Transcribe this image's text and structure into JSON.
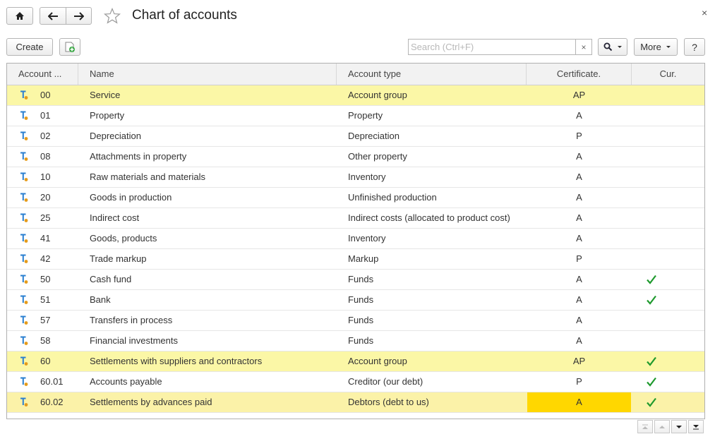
{
  "window": {
    "title": "Chart of accounts",
    "close_glyph": "×"
  },
  "toolbar": {
    "create_label": "Create",
    "more_label": "More",
    "help_label": "?",
    "search_placeholder": "Search (Ctrl+F)",
    "search_value": "",
    "clear_glyph": "×"
  },
  "columns": [
    "Account ...",
    "Name",
    "Account type",
    "Certificate.",
    "Cur."
  ],
  "rows": [
    {
      "code": "00",
      "name": "Service",
      "type": "Account group",
      "cert": "AP",
      "cur": false,
      "group": true
    },
    {
      "code": "01",
      "name": "Property",
      "type": "Property",
      "cert": "A",
      "cur": false
    },
    {
      "code": "02",
      "name": "Depreciation",
      "type": "Depreciation",
      "cert": "P",
      "cur": false
    },
    {
      "code": "08",
      "name": "Attachments in property",
      "type": "Other property",
      "cert": "A",
      "cur": false
    },
    {
      "code": "10",
      "name": "Raw materials and materials",
      "type": "Inventory",
      "cert": "A",
      "cur": false
    },
    {
      "code": "20",
      "name": "Goods in production",
      "type": "Unfinished production",
      "cert": "A",
      "cur": false
    },
    {
      "code": "25",
      "name": "Indirect cost",
      "type": "Indirect costs (allocated to product cost)",
      "cert": "A",
      "cur": false
    },
    {
      "code": "41",
      "name": "Goods, products",
      "type": "Inventory",
      "cert": "A",
      "cur": false
    },
    {
      "code": "42",
      "name": "Trade markup",
      "type": "Markup",
      "cert": "P",
      "cur": false
    },
    {
      "code": "50",
      "name": "Cash fund",
      "type": "Funds",
      "cert": "A",
      "cur": true
    },
    {
      "code": "51",
      "name": "Bank",
      "type": "Funds",
      "cert": "A",
      "cur": true
    },
    {
      "code": "57",
      "name": "Transfers in process",
      "type": "Funds",
      "cert": "A",
      "cur": false
    },
    {
      "code": "58",
      "name": "Financial investments",
      "type": "Funds",
      "cert": "A",
      "cur": false
    },
    {
      "code": "60",
      "name": "Settlements with suppliers and contractors",
      "type": "Account group",
      "cert": "AP",
      "cur": true,
      "group": true
    },
    {
      "code": "60.01",
      "name": "Accounts payable",
      "type": "Creditor (our debt)",
      "cert": "P",
      "cur": true
    },
    {
      "code": "60.02",
      "name": "Settlements by advances paid",
      "type": "Debtors (debt to us)",
      "cert": "A",
      "cur": true,
      "current": true
    }
  ],
  "colors": {
    "group_row": "#fbf7a6",
    "current_cell": "#ffd700",
    "check": "#1f9a2e"
  }
}
